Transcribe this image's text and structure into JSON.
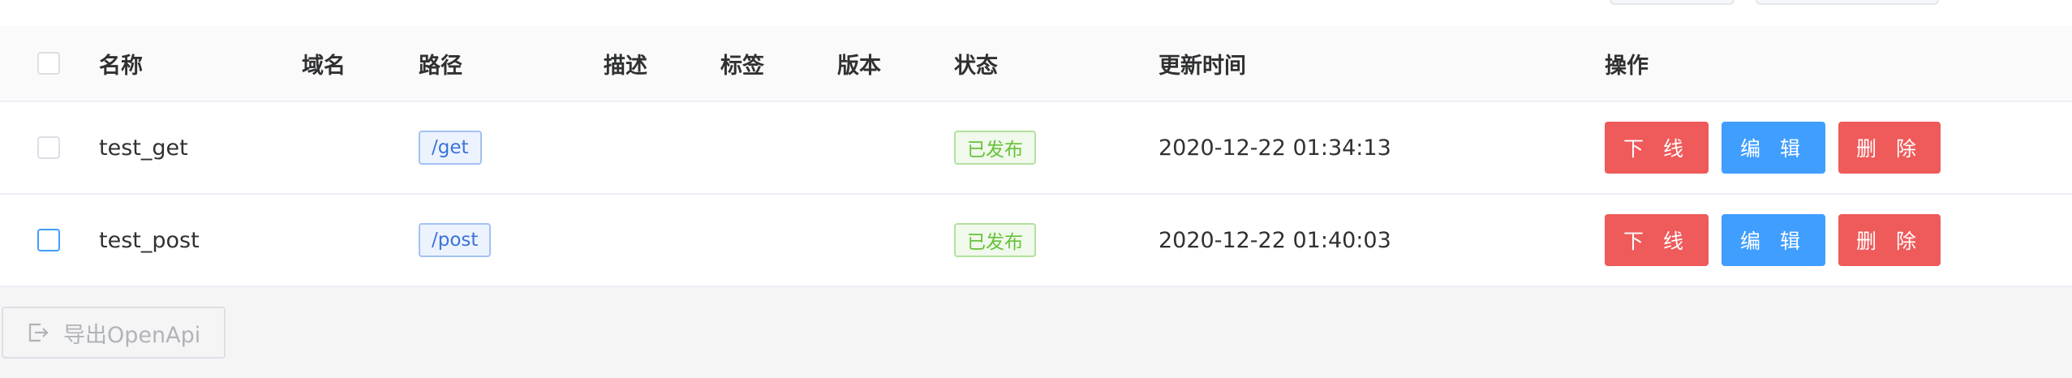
{
  "table": {
    "columns": {
      "name": "名称",
      "domain": "域名",
      "path": "路径",
      "desc": "描述",
      "tags": "标签",
      "version": "版本",
      "status": "状态",
      "updated": "更新时间",
      "actions": "操作"
    },
    "rows": [
      {
        "name": "test_get",
        "domain": "",
        "path": "/get",
        "desc": "",
        "tags": "",
        "version": "",
        "status": "已发布",
        "updated": "2020-12-22 01:34:13"
      },
      {
        "name": "test_post",
        "domain": "",
        "path": "/post",
        "desc": "",
        "tags": "",
        "version": "",
        "status": "已发布",
        "updated": "2020-12-22 01:40:03"
      }
    ],
    "action_labels": {
      "offline": "下 线",
      "edit": "编 辑",
      "delete": "删 除"
    }
  },
  "footer": {
    "export_label": "导出OpenApi",
    "export_icon": "export-icon"
  },
  "colors": {
    "danger": "#ef5a5a",
    "primary": "#409eff",
    "success": "#67c23a",
    "link": "#3b73d8"
  }
}
